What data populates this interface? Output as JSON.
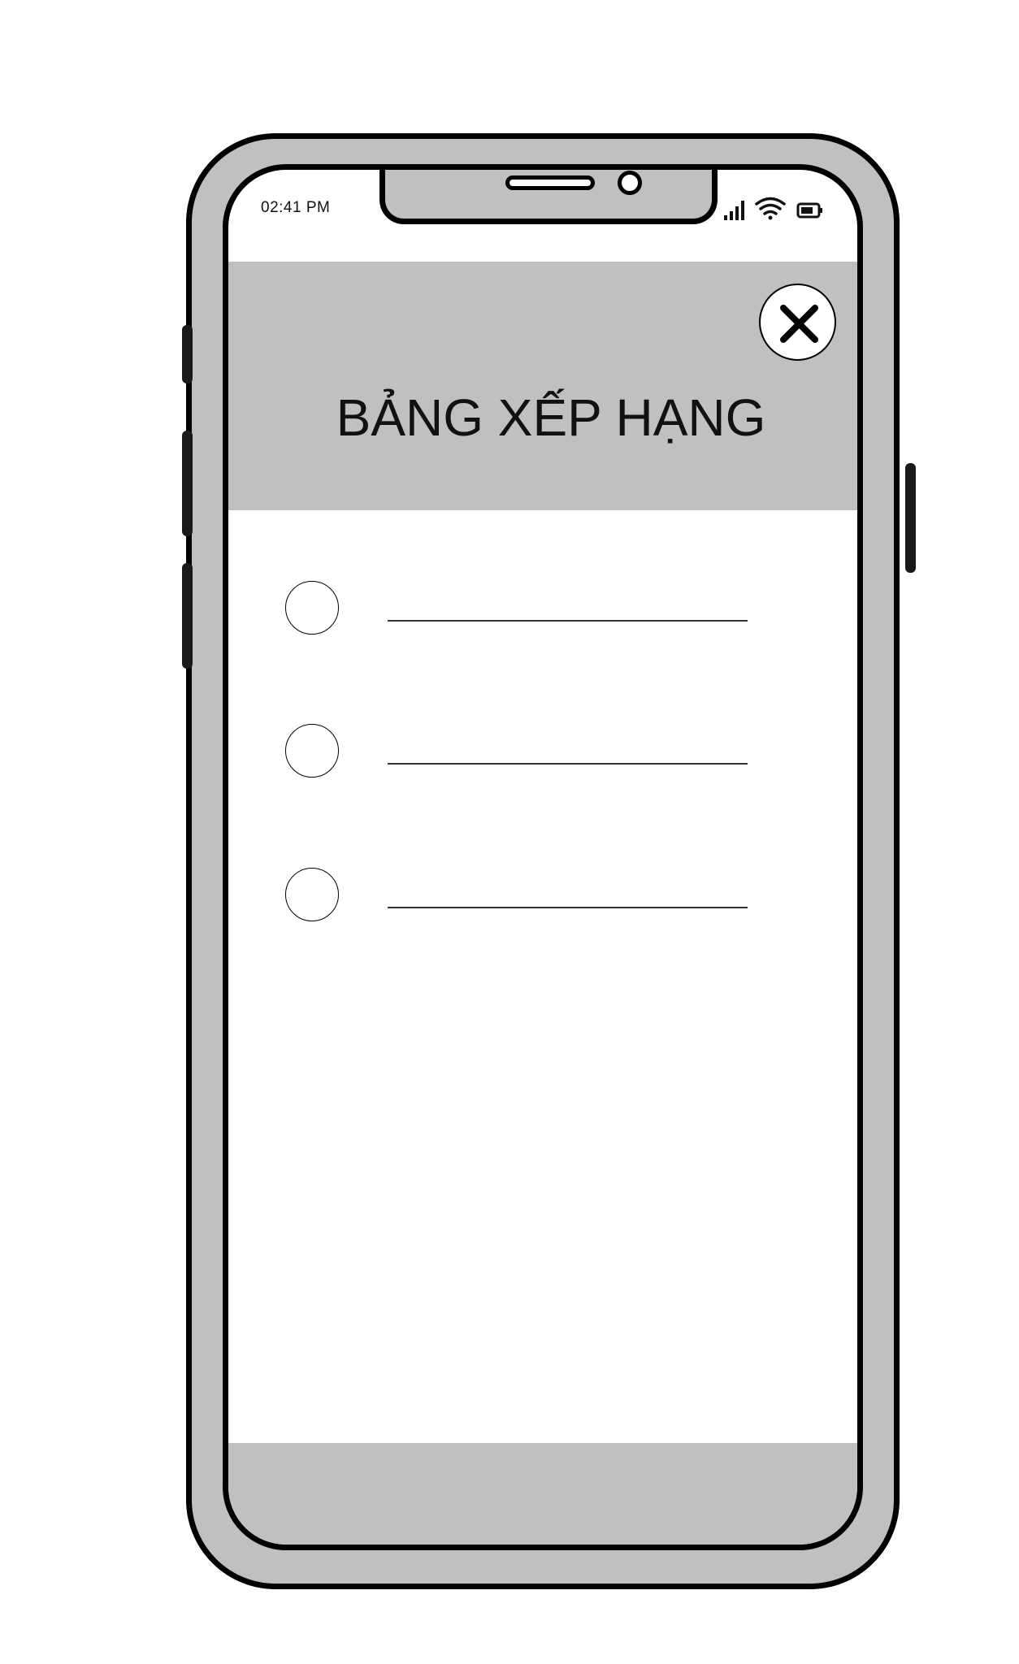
{
  "status_bar": {
    "time": "02:41 PM",
    "icons": [
      "signal-icon",
      "wifi-icon",
      "battery-icon"
    ]
  },
  "header": {
    "title": "BẢNG XẾP HẠNG",
    "close_icon": "close-icon"
  },
  "leaderboard": {
    "items": [
      {
        "selected": false,
        "label": ""
      },
      {
        "selected": false,
        "label": ""
      },
      {
        "selected": false,
        "label": ""
      }
    ]
  },
  "colors": {
    "frame": "#c0c0c0",
    "outline": "#000000",
    "screen": "#ffffff"
  }
}
